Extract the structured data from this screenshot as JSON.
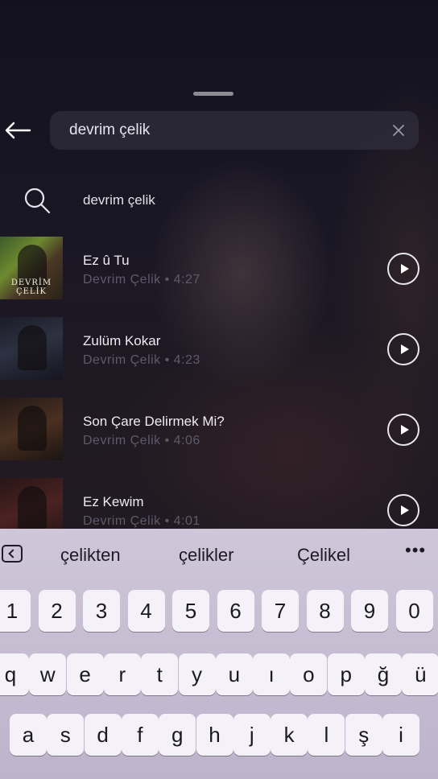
{
  "search": {
    "query": "devrim çelik"
  },
  "suggestion": {
    "text": "devrim çelik"
  },
  "songs": [
    {
      "title": "Ez û Tu",
      "meta": "Devrim Çelik • 4:27",
      "cover_text": "DEVRİM ÇELİK"
    },
    {
      "title": "Zulüm Kokar",
      "meta": "Devrim Çelik • 4:23"
    },
    {
      "title": "Son Çare Delirmek Mi?",
      "meta": "Devrim Çelik • 4:06"
    },
    {
      "title": "Ez Kewim",
      "meta": "Devrim Çelik • 4:01"
    }
  ],
  "keyboard": {
    "suggestions": [
      "çelikten",
      "çelikler",
      "Çelikel"
    ],
    "more": "•••",
    "numbers": [
      "1",
      "2",
      "3",
      "4",
      "5",
      "6",
      "7",
      "8",
      "9",
      "0"
    ],
    "row1": [
      "q",
      "w",
      "e",
      "r",
      "t",
      "y",
      "u",
      "ı",
      "o",
      "p",
      "ğ",
      "ü"
    ],
    "row2": [
      "a",
      "s",
      "d",
      "f",
      "g",
      "h",
      "j",
      "k",
      "l",
      "ş",
      "i"
    ]
  }
}
